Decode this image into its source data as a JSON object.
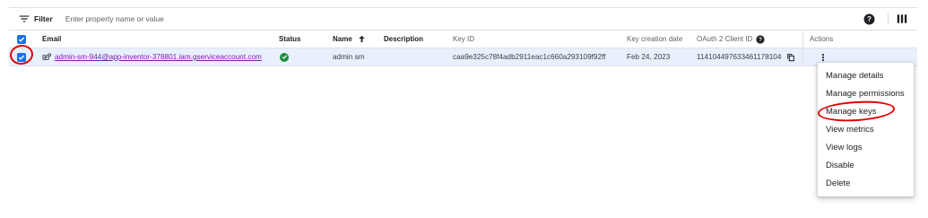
{
  "filter": {
    "label": "Filter",
    "placeholder": "Enter property name or value"
  },
  "table": {
    "headers": {
      "email": "Email",
      "status": "Status",
      "name": "Name",
      "description": "Description",
      "key_id": "Key ID",
      "key_creation_date": "Key creation date",
      "oauth_client_id": "OAuth 2 Client ID",
      "actions": "Actions"
    },
    "sort": {
      "column": "name",
      "direction": "ascending"
    },
    "rows": [
      {
        "selected": true,
        "email": "admin-sm-944@app-inventor-378801.iam.gserviceaccount.com",
        "status": "enabled",
        "name": "admin sm",
        "description": "",
        "key_id": "caa9e325c78f4adb2911eac1c660a293109f92ff",
        "key_creation_date": "Feb 24, 2023",
        "oauth_client_id": "114104497633461178104"
      }
    ]
  },
  "menu": {
    "items": [
      "Manage details",
      "Manage permissions",
      "Manage keys",
      "View metrics",
      "View logs",
      "Disable",
      "Delete"
    ]
  },
  "colors": {
    "accent": "#1a73e8",
    "row_selected_bg": "#e8f0fe",
    "link_visited": "#7b1fa2",
    "status_green": "#1e8e3e",
    "annotation_red": "#e00000"
  },
  "icons": {
    "filter": "filter-icon",
    "help": "help-icon",
    "columns": "column-display-icon",
    "sort": "arrow-up-icon",
    "service_account": "service-account-icon",
    "status": "check-circle-icon",
    "copy": "copy-icon",
    "more": "more-vert-icon"
  }
}
